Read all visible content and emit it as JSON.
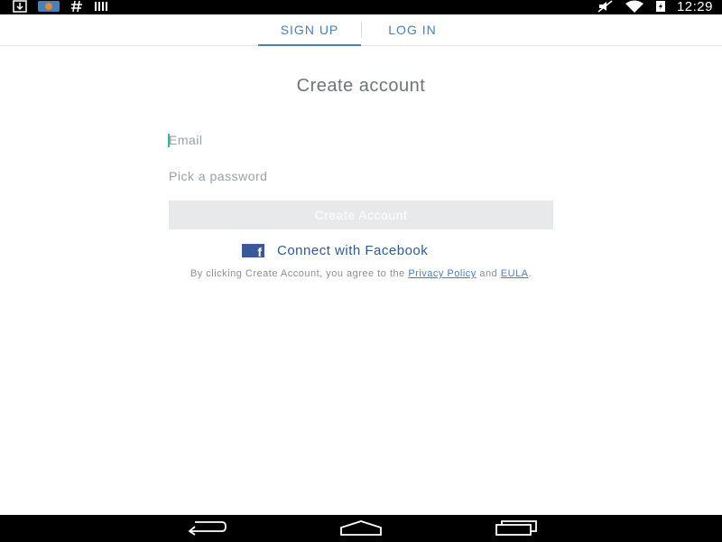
{
  "status_bar": {
    "time": "12:29",
    "left_icons": [
      "download-icon",
      "app-notification-icon",
      "hashtag-icon",
      "barcode-icon"
    ],
    "right_icons": [
      "mute-icon",
      "wifi-icon",
      "battery-icon"
    ]
  },
  "tabs": [
    {
      "label": "SIGN UP",
      "active": true
    },
    {
      "label": "LOG IN",
      "active": false
    }
  ],
  "form": {
    "title": "Create account",
    "email_placeholder": "Email",
    "password_placeholder": "Pick a password",
    "create_button_label": "Create Account",
    "facebook_label": "Connect with Facebook"
  },
  "legal": {
    "prefix": "By clicking Create Account, you agree to the",
    "privacy_link": "Privacy Policy",
    "and": "and",
    "eula_link": "EULA",
    "suffix": "."
  },
  "colors": {
    "accent": "#4a7fb8",
    "facebook": "#3b5998",
    "button_disabled": "#e8e9ea"
  }
}
